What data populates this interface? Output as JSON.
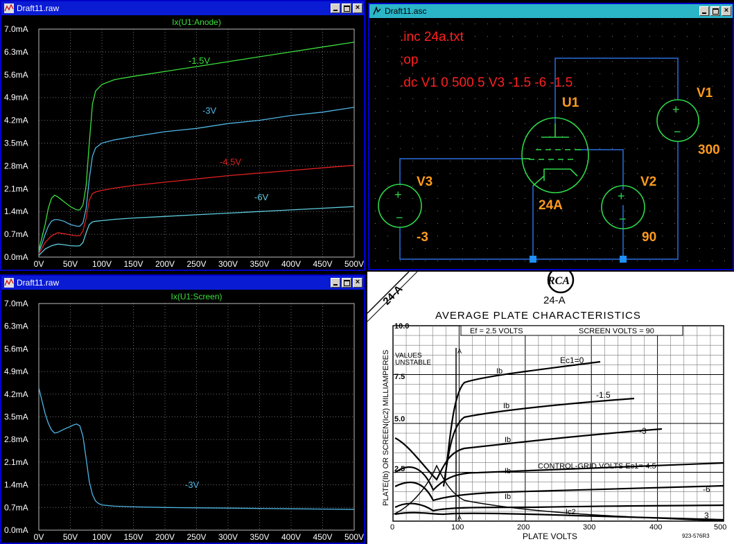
{
  "windows": {
    "anode": {
      "title": "Draft11.raw",
      "close": "×"
    },
    "schematic": {
      "title": "Draft11.asc",
      "close": "×"
    },
    "screen": {
      "title": "Draft11.raw",
      "close": "×"
    }
  },
  "colors": {
    "green": "#3ce03c",
    "cyan": "#4fb6e6",
    "red": "#e02020",
    "lightcyan": "#5ecfe0",
    "wire": "#2a6fe0",
    "component": "#2ed84a",
    "label_orange": "#ff9b1e",
    "directive_red": "#ff2020"
  },
  "chart_data": [
    {
      "type": "line",
      "title": "Ix(U1:Anode)",
      "xlabel": "",
      "ylabel": "",
      "x_ticks": [
        "0V",
        "50V",
        "100V",
        "150V",
        "200V",
        "250V",
        "300V",
        "350V",
        "400V",
        "450V",
        "500V"
      ],
      "y_ticks": [
        "0.0mA",
        "0.7mA",
        "1.4mA",
        "2.1mA",
        "2.8mA",
        "3.5mA",
        "4.2mA",
        "4.9mA",
        "5.6mA",
        "6.3mA",
        "7.0mA"
      ],
      "xlim": [
        0,
        500
      ],
      "ylim": [
        0,
        7.0
      ],
      "grid": true,
      "series": [
        {
          "name": "-1.5V",
          "color": "#3ce03c",
          "x": [
            0,
            5,
            10,
            15,
            20,
            25,
            30,
            40,
            50,
            60,
            65,
            70,
            75,
            80,
            85,
            90,
            100,
            120,
            150,
            200,
            250,
            300,
            350,
            400,
            450,
            500
          ],
          "y": [
            0.2,
            0.6,
            1.0,
            1.5,
            1.8,
            1.9,
            1.85,
            1.7,
            1.55,
            1.45,
            1.45,
            1.6,
            2.2,
            3.5,
            4.7,
            5.1,
            5.3,
            5.45,
            5.55,
            5.7,
            5.85,
            6.0,
            6.15,
            6.3,
            6.45,
            6.6
          ]
        },
        {
          "name": "-3V",
          "color": "#4fb6e6",
          "x": [
            0,
            5,
            10,
            15,
            20,
            25,
            30,
            40,
            50,
            60,
            65,
            70,
            75,
            80,
            85,
            90,
            100,
            120,
            150,
            200,
            250,
            300,
            350,
            400,
            450,
            500
          ],
          "y": [
            0.15,
            0.4,
            0.7,
            0.95,
            1.1,
            1.15,
            1.15,
            1.1,
            1.0,
            0.95,
            0.95,
            1.05,
            1.5,
            2.4,
            3.1,
            3.35,
            3.5,
            3.6,
            3.7,
            3.85,
            3.95,
            4.1,
            4.2,
            4.35,
            4.45,
            4.6
          ]
        },
        {
          "name": "-4.5V",
          "color": "#e02020",
          "x": [
            0,
            10,
            20,
            30,
            40,
            50,
            60,
            65,
            70,
            75,
            80,
            85,
            90,
            100,
            120,
            150,
            200,
            250,
            300,
            350,
            400,
            450,
            500
          ],
          "y": [
            0.1,
            0.45,
            0.65,
            0.75,
            0.72,
            0.68,
            0.65,
            0.66,
            0.8,
            1.2,
            1.75,
            1.95,
            2.0,
            2.05,
            2.12,
            2.2,
            2.3,
            2.4,
            2.5,
            2.58,
            2.66,
            2.74,
            2.82
          ]
        },
        {
          "name": "-6V",
          "color": "#5ecfe0",
          "x": [
            0,
            10,
            20,
            30,
            40,
            50,
            60,
            65,
            70,
            75,
            80,
            85,
            90,
            100,
            120,
            150,
            200,
            250,
            300,
            350,
            400,
            450,
            500
          ],
          "y": [
            0.05,
            0.25,
            0.35,
            0.4,
            0.38,
            0.35,
            0.34,
            0.35,
            0.45,
            0.75,
            1.0,
            1.08,
            1.1,
            1.12,
            1.16,
            1.2,
            1.25,
            1.3,
            1.35,
            1.4,
            1.45,
            1.5,
            1.55
          ]
        }
      ]
    },
    {
      "type": "line",
      "title": "Ix(U1:Screen)",
      "xlabel": "",
      "ylabel": "",
      "x_ticks": [
        "0V",
        "50V",
        "100V",
        "150V",
        "200V",
        "250V",
        "300V",
        "350V",
        "400V",
        "450V",
        "500V"
      ],
      "y_ticks": [
        "0.0mA",
        "0.7mA",
        "1.4mA",
        "2.1mA",
        "2.8mA",
        "3.5mA",
        "4.2mA",
        "4.9mA",
        "5.6mA",
        "6.3mA",
        "7.0mA"
      ],
      "xlim": [
        0,
        500
      ],
      "ylim": [
        0,
        7.0
      ],
      "grid": true,
      "series": [
        {
          "name": "-3V",
          "color": "#4fb6e6",
          "x": [
            0,
            5,
            10,
            15,
            20,
            25,
            30,
            40,
            50,
            55,
            60,
            65,
            70,
            75,
            80,
            85,
            90,
            95,
            100,
            120,
            150,
            200,
            250,
            300,
            350,
            400,
            450,
            500
          ],
          "y": [
            4.4,
            4.0,
            3.6,
            3.3,
            3.1,
            3.0,
            3.02,
            3.12,
            3.2,
            3.25,
            3.28,
            3.22,
            2.9,
            2.2,
            1.5,
            1.1,
            0.9,
            0.82,
            0.78,
            0.74,
            0.72,
            0.7,
            0.69,
            0.68,
            0.67,
            0.66,
            0.65,
            0.64
          ]
        }
      ]
    }
  ],
  "schematic": {
    "directives": [
      ".inc 24a.txt",
      ";op",
      ".dc V1 0 500 5 V3 -1.5 -6 -1.5"
    ],
    "tube": {
      "ref": "U1",
      "value": "24A"
    },
    "sources": [
      {
        "ref": "V1",
        "value": "300"
      },
      {
        "ref": "V2",
        "value": "90"
      },
      {
        "ref": "V3",
        "value": "-3"
      }
    ],
    "plus": "+",
    "minus": "−"
  },
  "datasheet": {
    "corner_label": "24-A",
    "logo": "RCA",
    "tube_name": "24-A",
    "heading": "AVERAGE PLATE CHARACTERISTICS",
    "conditions_left": "Ef = 2.5 VOLTS",
    "conditions_right": "SCREEN VOLTS = 90",
    "y_axis_label": "PLATE(Ib) OR SCREEN(Ic2) MILLIAMPERES",
    "x_axis_label": "PLATE VOLTS",
    "code": "923-576R3",
    "unstable_note": [
      "VALUES",
      "UNSTABLE"
    ],
    "marker_a": "A",
    "y_ticks": [
      "10.0",
      "7.5",
      "5.0",
      "2.5"
    ],
    "x_ticks": [
      "0",
      "100",
      "200",
      "300",
      "400",
      "500"
    ],
    "curve_labels": [
      "Ec1=0",
      "-1.5",
      "-3",
      "CONTROL-GRID VOLTS Ec1=-4.5",
      "-6"
    ],
    "ib_label": "Ib",
    "ic2_label": "Ic2",
    "corner_3": "3"
  }
}
